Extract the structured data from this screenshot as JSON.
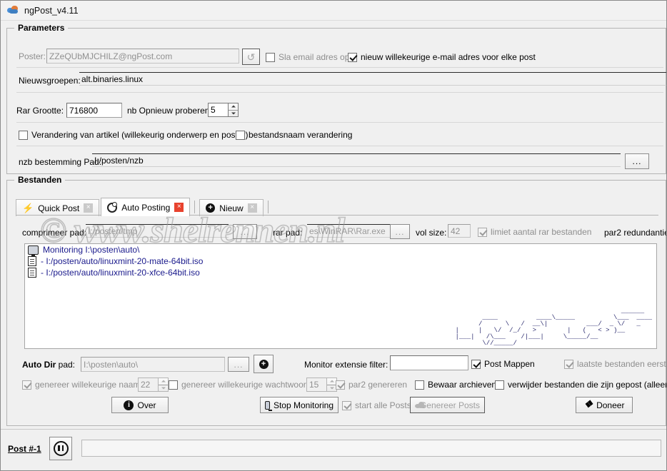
{
  "window": {
    "title": "ngPost_v4.11",
    "icon": "cloud-icon"
  },
  "parameters": {
    "group_title": "Parameters",
    "poster_label": "Poster:",
    "poster_value": "ZZeQUbMJCHILZ@ngPost.com",
    "refresh_icon": "refresh-icon",
    "save_email_label": "Sla email adres op",
    "save_email_checked": false,
    "new_random_email_label": "nieuw willekeurige e-mail adres voor elke post",
    "new_random_email_checked": true,
    "newsgroups_label": "Nieuwsgroepen:",
    "newsgroups_value": "alt.binaries.linux",
    "rar_size_label": "Rar Grootte:",
    "rar_size_value": "716800",
    "retry_label": "nb Opnieuw proberen:",
    "retry_value": "5",
    "article_change_label": "Verandering van artikel (willekeurig onderwerp en poster)",
    "article_change_checked": false,
    "filename_change_label": "bestandsnaam verandering",
    "filename_change_checked": false,
    "nzb_path_label": "nzb bestemming Pad:",
    "nzb_path_value": "I:/posten/nzb",
    "browse_label": "..."
  },
  "files": {
    "group_title": "Bestanden",
    "tabs": [
      {
        "label": "Quick Post",
        "icon": "lightning-icon",
        "close": "×",
        "active": false,
        "close_red": false
      },
      {
        "label": "Auto Posting",
        "icon": "auto-gear-icon",
        "close": "×",
        "active": true,
        "close_red": true
      },
      {
        "label": "Nieuw",
        "icon": "plus-circle-icon",
        "close": "×",
        "active": false,
        "close_red": false
      }
    ],
    "compress_path_label": "comprimeer pad:",
    "compress_path_value": "I:/posten/tmp",
    "compress_browse_label": "...",
    "rar_path_label": "rar pad:",
    "rar_path_value": "es\\WinRAR\\Rar.exe",
    "rar_browse_label": "...",
    "vol_size_label": "vol size:",
    "vol_size_value": "42",
    "limit_rar_label": "limiet aantal rar bestanden",
    "limit_rar_checked": true,
    "par2_redundancy_label": "par2 redundantie",
    "list_items": [
      {
        "icon": "monitor-icon",
        "text": "Monitoring I:\\posten\\auto\\"
      },
      {
        "icon": "file-icon",
        "text": "- I:/posten/auto/linuxmint-20-mate-64bit.iso"
      },
      {
        "icon": "file-icon",
        "text": "- I:/posten/auto/linuxmint-20-xfce-64bit.iso"
      }
    ],
    "ascii_art": "                                              ______\n          ____          ____\\_____          \\___  ____\n         /      \\   /  __\\|          ___/  _ \\/   _\n   |     |   \\/  /_/   >        |   (   < > )__\n   |___|   /\\___    /|___|     \\_____/__\n          \\//_____/",
    "auto_dir_label_bold": "Auto Dir",
    "auto_dir_label_rest": " pad:",
    "auto_dir_value": "I:\\posten\\auto\\",
    "auto_dir_browse_label": "...",
    "auto_dir_add_icon": "plus-circle-icon",
    "monitor_filter_label": "Monitor extensie filter:",
    "monitor_filter_value": "",
    "post_folders_label": "Post Mappen",
    "post_folders_checked": true,
    "latest_files_first_label": "laatste bestanden eerst",
    "latest_files_first_checked": true,
    "random_name_label": "genereer willekeurige naam",
    "random_name_checked": true,
    "random_name_len": "22",
    "random_pass_label": "genereer willekeurige wachtwoord",
    "random_pass_checked": false,
    "random_pass_len": "15",
    "par2_generate_label": "par2 genereren",
    "par2_generate_checked": true,
    "keep_archives_label": "Bewaar archieven",
    "keep_archives_checked": false,
    "delete_posted_label": "verwijder bestanden die  zijn gepost (alleen vo",
    "delete_posted_checked": false
  },
  "buttons": {
    "about_label": "Over",
    "about_icon": "info-icon",
    "stop_monitoring_label": "Stop Monitoring",
    "stop_monitoring_icon": "monitor-icon",
    "start_all_posts_label": "start alle Posts",
    "start_all_posts_checked": true,
    "generate_posts_label": "Genereer Posts",
    "generate_posts_icon": "cloud-icon",
    "donate_label": "Doneer",
    "donate_icon": "donate-icon"
  },
  "statusbar": {
    "post_link": "Post #-1",
    "pause_icon": "pause-icon",
    "progress_value": ""
  },
  "watermark": {
    "text": "© www.shelrennen.nl"
  },
  "colors": {
    "accent_red": "#e8422e",
    "link_blue": "#1a1a8c",
    "window_bg": "#f0f0f0"
  }
}
